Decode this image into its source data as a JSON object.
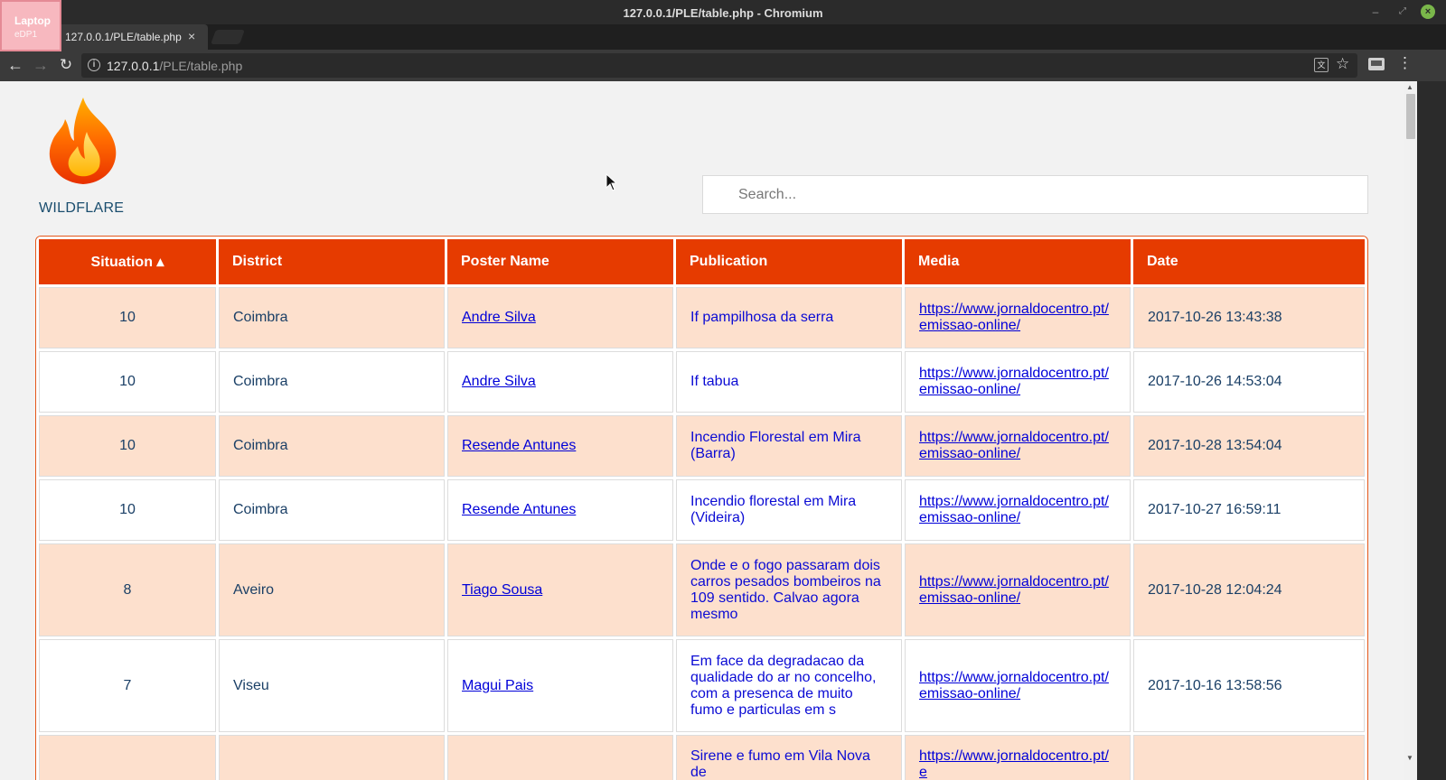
{
  "window": {
    "title": "127.0.0.1/PLE/table.php - Chromium",
    "badge_title": "Laptop",
    "badge_sub": "eDP1"
  },
  "tab": {
    "title": "127.0.0.1/PLE/table.php"
  },
  "omnibox": {
    "host": "127.0.0.1",
    "path": "/PLE/table.php"
  },
  "header": {
    "brand": "WILDFLARE",
    "search_placeholder": "Search..."
  },
  "table": {
    "columns": [
      "Situation ▴",
      "District",
      "Poster Name",
      "Publication",
      "Media",
      "Date"
    ],
    "rows": [
      {
        "situation": "10",
        "district": "Coimbra",
        "poster": "Andre Silva",
        "publication": "If pampilhosa da serra",
        "media": "https://www.jornaldocentro.pt/emissao-online/",
        "date": "2017-10-26 13:43:38"
      },
      {
        "situation": "10",
        "district": "Coimbra",
        "poster": "Andre Silva",
        "publication": "If tabua",
        "media": "https://www.jornaldocentro.pt/emissao-online/",
        "date": "2017-10-26 14:53:04"
      },
      {
        "situation": "10",
        "district": "Coimbra",
        "poster": "Resende Antunes",
        "publication": "Incendio Florestal em Mira (Barra)",
        "media": "https://www.jornaldocentro.pt/emissao-online/",
        "date": "2017-10-28 13:54:04"
      },
      {
        "situation": "10",
        "district": "Coimbra",
        "poster": "Resende Antunes",
        "publication": "Incendio florestal em Mira (Videira)",
        "media": "https://www.jornaldocentro.pt/emissao-online/",
        "date": "2017-10-27 16:59:11"
      },
      {
        "situation": "8",
        "district": "Aveiro",
        "poster": "Tiago Sousa",
        "publication": "Onde e o fogo passaram dois carros pesados bombeiros na 109 sentido. Calvao agora mesmo",
        "media": "https://www.jornaldocentro.pt/emissao-online/",
        "date": "2017-10-28 12:04:24"
      },
      {
        "situation": "7",
        "district": "Viseu",
        "poster": "Magui Pais",
        "publication": "Em face da degradacao da qualidade do ar no concelho, com a presenca de muito fumo e particulas em s",
        "media": "https://www.jornaldocentro.pt/emissao-online/",
        "date": "2017-10-16 13:58:56"
      },
      {
        "situation": "",
        "district": "",
        "poster": "",
        "publication": "Sirene e fumo em Vila Nova de",
        "media": "https://www.jornaldocentro.pt/e",
        "date": ""
      }
    ]
  },
  "colors": {
    "header_bg": "#e63b00",
    "odd_row": "#fde0cd",
    "link": "#0000d8"
  }
}
